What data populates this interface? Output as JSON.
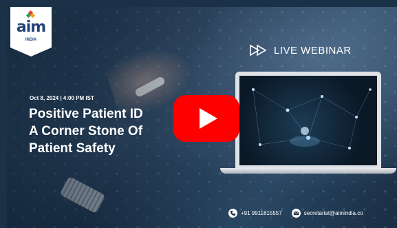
{
  "logo": {
    "word": "aim",
    "subtitle": "INDIA"
  },
  "badge": {
    "label": "LIVE WEBINAR"
  },
  "event": {
    "date_time": "Oct 8, 2024 | 4:00 PM IST",
    "title_lines": [
      "Positive Patient ID",
      "A Corner Stone Of",
      "Patient Safety"
    ]
  },
  "contact": {
    "phone": "+91 9911815557",
    "email": "secretariat@aimindia.co"
  },
  "colors": {
    "brand_blue": "#24427a",
    "play_red": "#ff0000"
  }
}
